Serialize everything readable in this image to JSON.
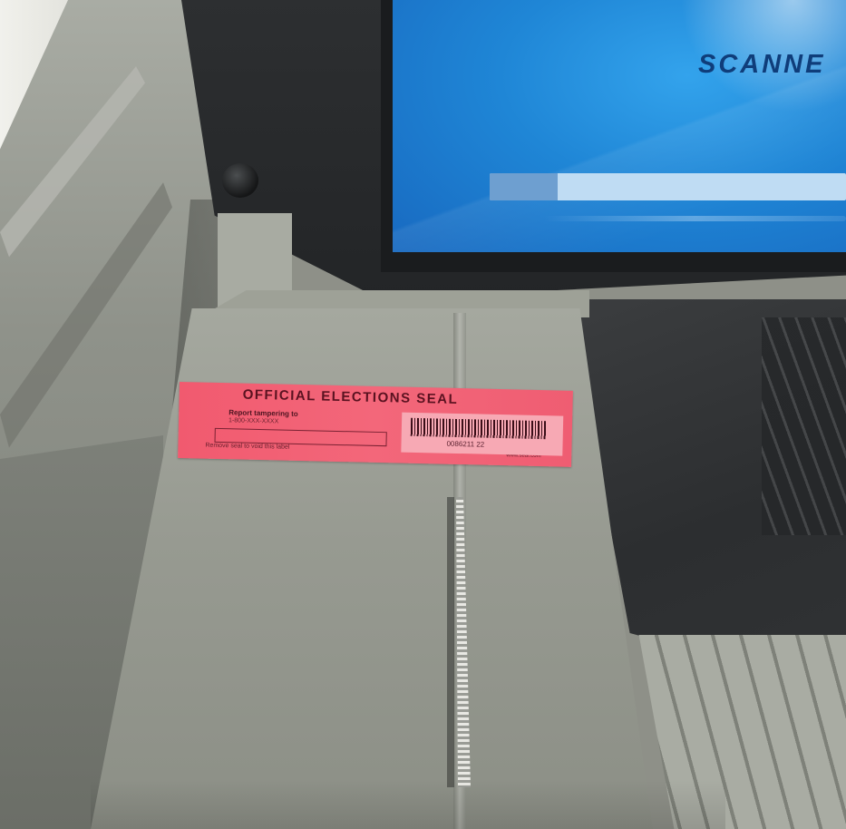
{
  "screen": {
    "title": "SCANNE",
    "progress_fraction": 0.19
  },
  "seal": {
    "title": "OFFICIAL ELECTIONS SEAL",
    "line1": "Report tampering to",
    "line2": "1-800-XXX-XXXX",
    "footer_left": "Remove seal to void this label",
    "footer_right": "www.seal.com",
    "barcode_number": "0086211 22"
  }
}
